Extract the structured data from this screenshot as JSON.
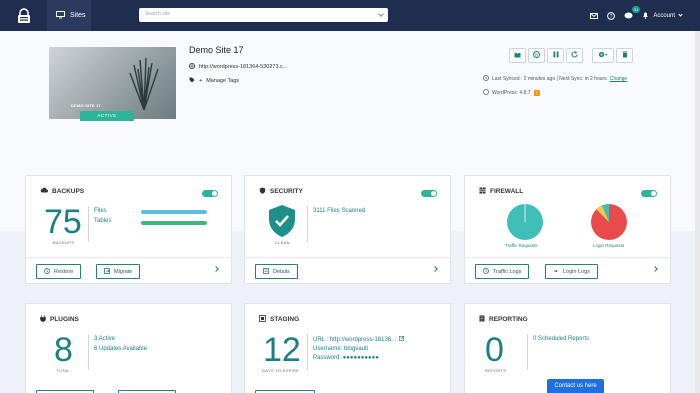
{
  "nav": {
    "sites_label": "Sites",
    "search_placeholder": "Search site",
    "account_label": "Account",
    "notification_count": "31"
  },
  "site": {
    "name": "Demo Site 17",
    "url": "http://wordpress-181364-530273.c...",
    "manage_tags": "Manage Tags",
    "thumbnail_title": "DEMO SITE 17",
    "status": "ACTIVE",
    "sync_text": "Last Synced : 2 minutes ago | Next Sync: in 2 hours",
    "sync_link": "Change",
    "wp_version": "WordPress: 4.8.7"
  },
  "backups": {
    "title": "BACKUPS",
    "count": "75",
    "count_label": "BACKUPS",
    "files_label": "Files",
    "tables_label": "Tables",
    "restore_label": "Restore",
    "migrate_label": "Migrate",
    "files_progress": 1.0,
    "tables_progress": 1.0
  },
  "security": {
    "title": "SECURITY",
    "files_scanned": "3111 Files Scanned",
    "shield_label": "CLEAN",
    "details_label": "Details"
  },
  "firewall": {
    "title": "FIREWALL",
    "traffic_label": "Traffic Requests",
    "login_label": "Login Requests",
    "traffic_logs_label": "Traffic Logs",
    "login_logs_label": "Login Logs"
  },
  "plugins": {
    "title": "PLUGINS",
    "count": "8",
    "count_label": "TOTAL",
    "active_text": "3 Active",
    "updates_text": "6 Updates Available"
  },
  "staging": {
    "title": "STAGING",
    "count": "12",
    "count_label": "DAYS TO EXPIRE",
    "url_text": "URL : http://wordpress-18136...",
    "username_text": "Username: blogvault",
    "password_text": "Password: ●●●●●●●●●●"
  },
  "reporting": {
    "title": "REPORTING",
    "count": "0",
    "count_label": "REPORTS",
    "scheduled_text": "0 Scheduled Reports"
  },
  "contact_label": "Contact us here",
  "colors": {
    "topbar": "#1f2d4e",
    "teal": "#1e7f83",
    "accent": "#2fb39a",
    "pie_red": "#e94b4b",
    "pie_yellow": "#f0c857",
    "pie_teal": "#3fbfb8",
    "bar_blue": "#5bc0de",
    "bar_green": "#3fb87f"
  }
}
